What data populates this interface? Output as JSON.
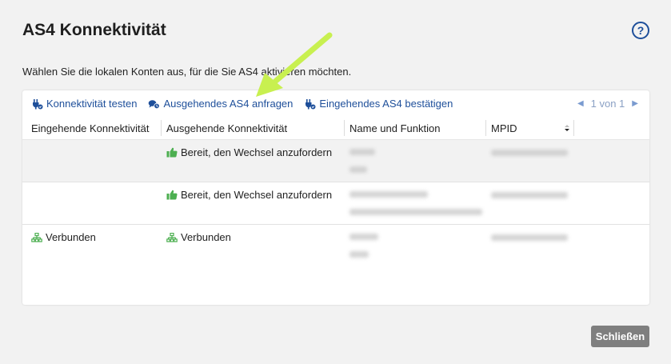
{
  "dialog": {
    "title": "AS4 Konnektivität",
    "help_label": "?",
    "description": "Wählen Sie die lokalen Konten aus, für die Sie AS4 aktivieren möchten.",
    "close_label": "Schließen"
  },
  "toolbar": {
    "test_label": "Konnektivität testen",
    "request_label": "Ausgehendes AS4 anfragen",
    "confirm_label": "Eingehendes AS4 bestätigen",
    "pager_text": "1 von 1"
  },
  "table": {
    "columns": [
      "Eingehende Konnektivität",
      "Ausgehende Konnektivität",
      "Name und Funktion",
      "MPID"
    ],
    "rows": [
      {
        "incoming": "",
        "outgoing": "Bereit, den Wechsel anzufordern",
        "outgoing_icon": "thumbs-up-icon",
        "incoming_icon": ""
      },
      {
        "incoming": "",
        "outgoing": "Bereit, den Wechsel anzufordern",
        "outgoing_icon": "thumbs-up-icon",
        "incoming_icon": ""
      },
      {
        "incoming": "Verbunden",
        "outgoing": "Verbunden",
        "outgoing_icon": "network-icon",
        "incoming_icon": "network-icon"
      }
    ]
  },
  "colors": {
    "link": "#1e4f9a",
    "status_green": "#4caf50",
    "annotation_arrow": "#c8f050",
    "close_button": "#7f7f7f"
  }
}
